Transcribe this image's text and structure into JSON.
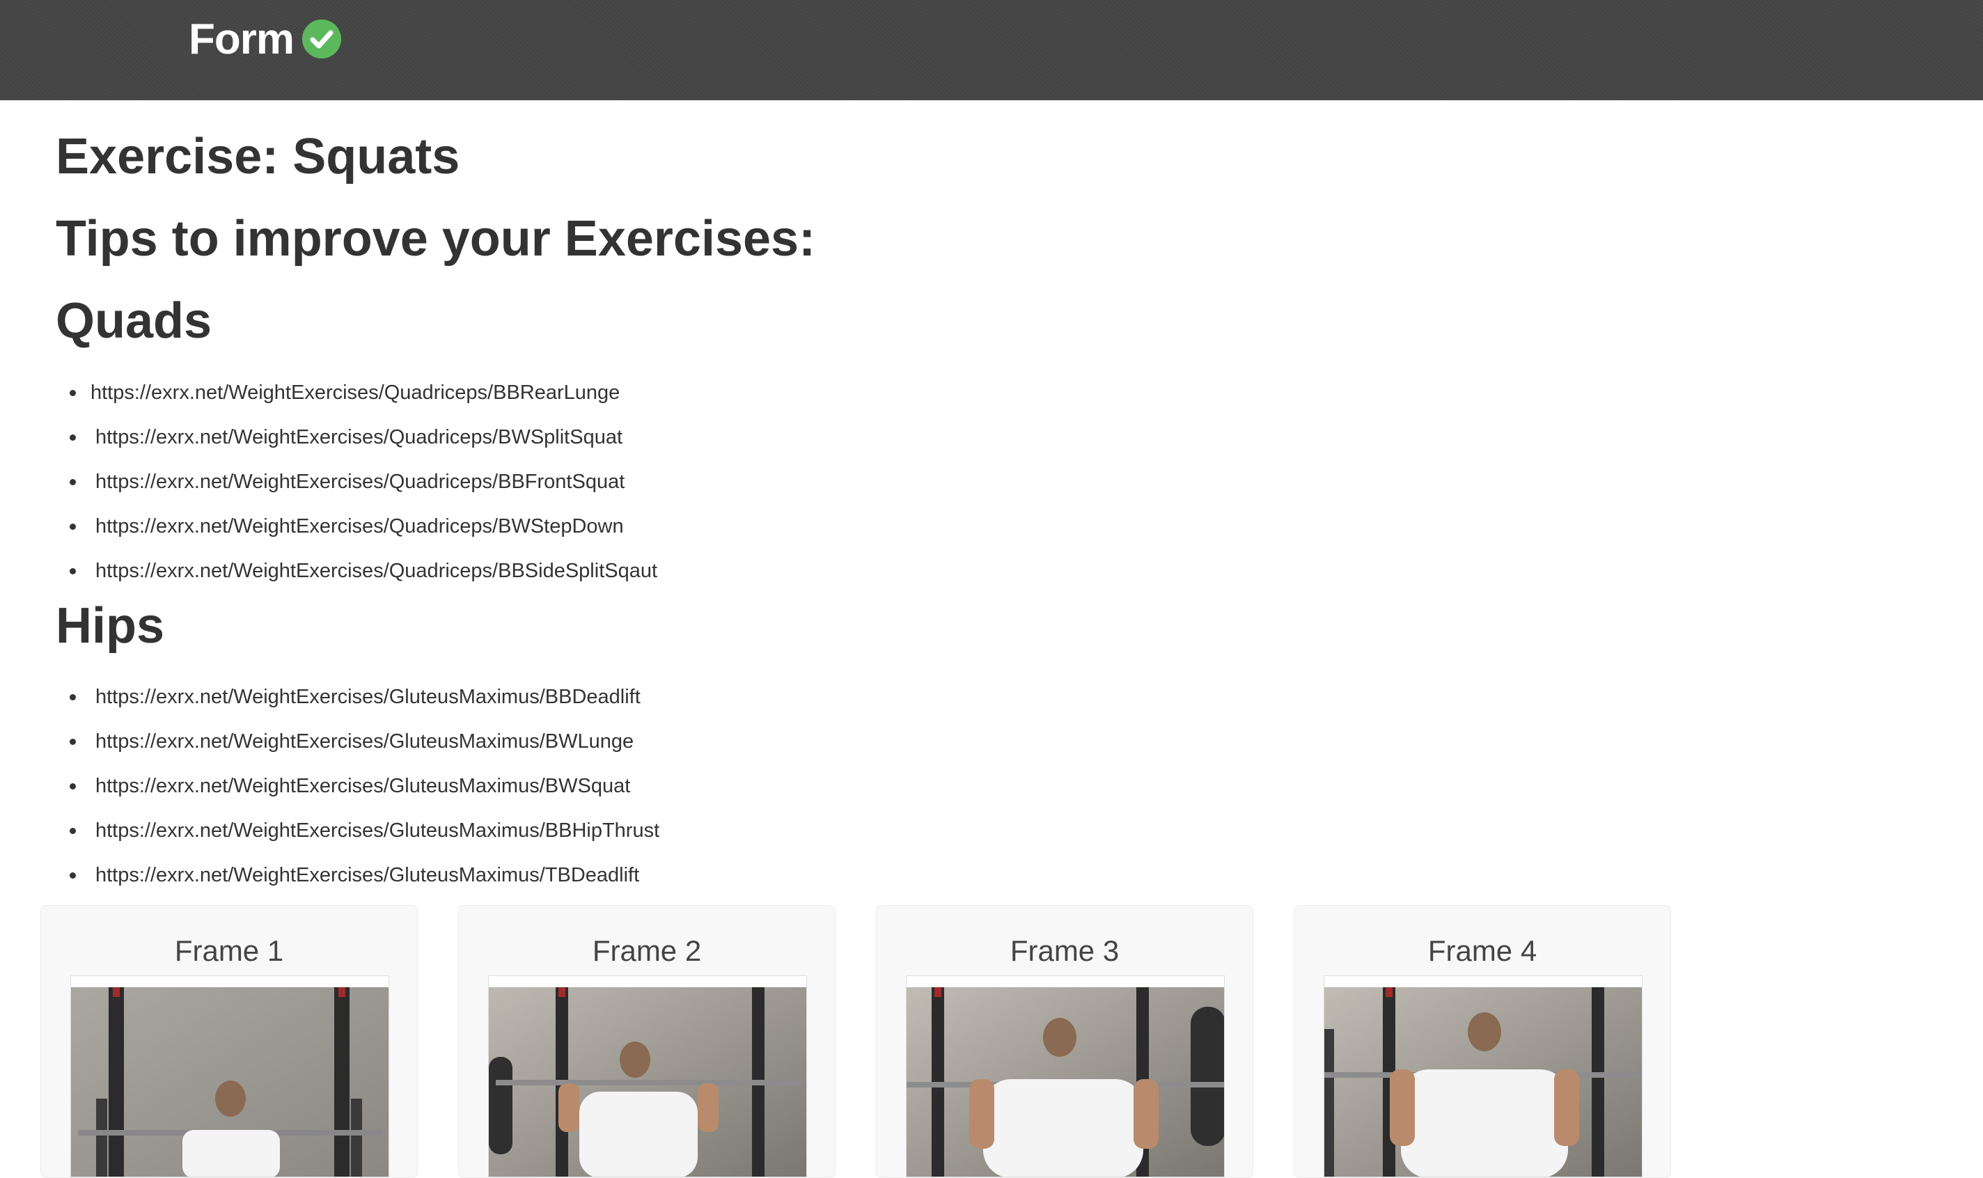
{
  "navbar": {
    "brand": "Form",
    "brand_icon": "check-circle-icon",
    "background": "#454545",
    "accent": "#5cb85c"
  },
  "page": {
    "exercise_heading": "Exercise: Squats",
    "tips_heading": "Tips to improve your Exercises:"
  },
  "groups": [
    {
      "title": "Quads",
      "links": [
        "https://exrx.net/WeightExercises/Quadriceps/BBRearLunge",
        "https://exrx.net/WeightExercises/Quadriceps/BWSplitSquat",
        "https://exrx.net/WeightExercises/Quadriceps/BBFrontSquat",
        "https://exrx.net/WeightExercises/Quadriceps/BWStepDown",
        "https://exrx.net/WeightExercises/Quadriceps/BBSideSplitSqaut"
      ]
    },
    {
      "title": "Hips",
      "links": [
        "https://exrx.net/WeightExercises/GluteusMaximus/BBDeadlift",
        "https://exrx.net/WeightExercises/GluteusMaximus/BWLunge",
        "https://exrx.net/WeightExercises/GluteusMaximus/BWSquat",
        "https://exrx.net/WeightExercises/GluteusMaximus/BBHipThrust",
        "https://exrx.net/WeightExercises/GluteusMaximus/TBDeadlift"
      ]
    }
  ],
  "frames": [
    {
      "title": "Frame 1"
    },
    {
      "title": "Frame 2"
    },
    {
      "title": "Frame 3"
    },
    {
      "title": "Frame 4"
    }
  ]
}
